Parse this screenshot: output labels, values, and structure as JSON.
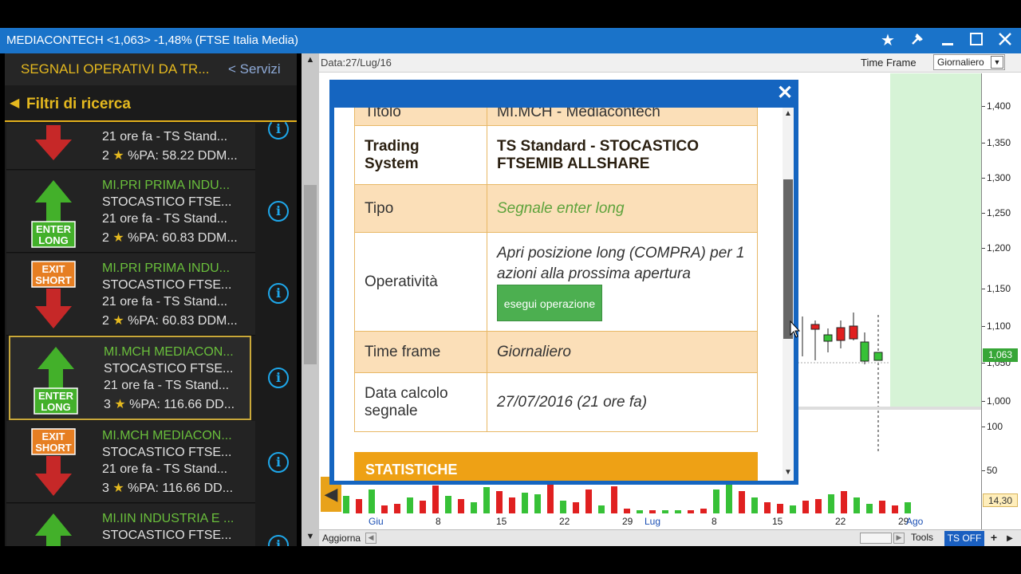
{
  "window": {
    "title": "MEDIACONTECH <1,063> -1,48%  (FTSE Italia Media)",
    "icons": [
      "star-icon",
      "pin-icon",
      "minimize-icon",
      "maximize-icon",
      "close-icon"
    ]
  },
  "left_panel": {
    "header_title": "SEGNALI OPERATIVI DA TR...",
    "header_link": "< Servizi",
    "filter_label": "Filtri di ricerca",
    "signals": [
      {
        "type": "down",
        "badge": "",
        "title": "",
        "subtitle": "",
        "time": "21 ore fa - TS Stand...",
        "stars": "2",
        "stats": "%PA: 58.22 DDM..."
      },
      {
        "type": "enter",
        "badge_line1": "ENTER",
        "badge_line2": "LONG",
        "title": "MI.PRI PRIMA INDU...",
        "subtitle": "STOCASTICO FTSE...",
        "time": "21 ore fa - TS Stand...",
        "stars": "2",
        "stats": "%PA: 60.83 DDM..."
      },
      {
        "type": "exit",
        "badge_line1": "EXIT",
        "badge_line2": "SHORT",
        "title": "MI.PRI PRIMA INDU...",
        "subtitle": "STOCASTICO FTSE...",
        "time": "21 ore fa - TS Stand...",
        "stars": "2",
        "stats": "%PA: 60.83 DDM..."
      },
      {
        "type": "enter",
        "badge_line1": "ENTER",
        "badge_line2": "LONG",
        "title": "MI.MCH MEDIACON...",
        "subtitle": "STOCASTICO FTSE...",
        "time": "21 ore fa - TS Stand...",
        "stars": "3",
        "stats": "%PA: 116.66 DD..."
      },
      {
        "type": "exit",
        "badge_line1": "EXIT",
        "badge_line2": "SHORT",
        "title": "MI.MCH MEDIACON...",
        "subtitle": "STOCASTICO FTSE...",
        "time": "21 ore fa - TS Stand...",
        "stars": "3",
        "stats": "%PA: 116.66 DD..."
      },
      {
        "type": "enter-partial",
        "badge_line1": "",
        "badge_line2": "",
        "title": "MI.IIN INDUSTRIA E ...",
        "subtitle": "STOCASTICO FTSE...",
        "time": "",
        "stars": "",
        "stats": ""
      }
    ],
    "info_glyph": "i"
  },
  "chart": {
    "date_label": "Data:27/Lug/16",
    "time_frame_label": "Time Frame",
    "time_frame_value": "Giornaliero",
    "price_ticks": [
      "1,400",
      "1,350",
      "1,300",
      "1,250",
      "1,200",
      "1,150",
      "1,100",
      "1,050",
      "1,000"
    ],
    "volume_ticks": [
      "100",
      "50"
    ],
    "last_price": "1,063",
    "volume_last": "14,30",
    "x_labels": [
      "Giu",
      "8",
      "15",
      "22",
      "29",
      "Lug",
      "8",
      "15",
      "22",
      "29",
      "Ago"
    ],
    "bottom": {
      "refresh": "Aggiorna",
      "tools": "Tools",
      "ts_off": "TS OFF",
      "plus": "+"
    },
    "colors": {
      "up": "#37c137",
      "down": "#e02020",
      "green_zone": "#d6f3d6"
    }
  },
  "modal": {
    "close_glyph": "✕",
    "rows": [
      {
        "key": "Titolo",
        "value": "MI.MCH - Mediacontech"
      },
      {
        "key": "Trading System",
        "value": "TS Standard - STOCASTICO FTSEMIB ALLSHARE"
      },
      {
        "key": "Tipo",
        "value": "Segnale enter long"
      },
      {
        "key": "Operatività",
        "value": "Apri posizione long (COMPRA) per 1 azioni alla prossima apertura"
      },
      {
        "key": "Time frame",
        "value": "Giornaliero"
      },
      {
        "key": "Data calcolo segnale",
        "value": "27/07/2016 (21 ore fa)"
      }
    ],
    "exec_button": "esegui operazione",
    "statistics_header": "STATISTICHE"
  }
}
